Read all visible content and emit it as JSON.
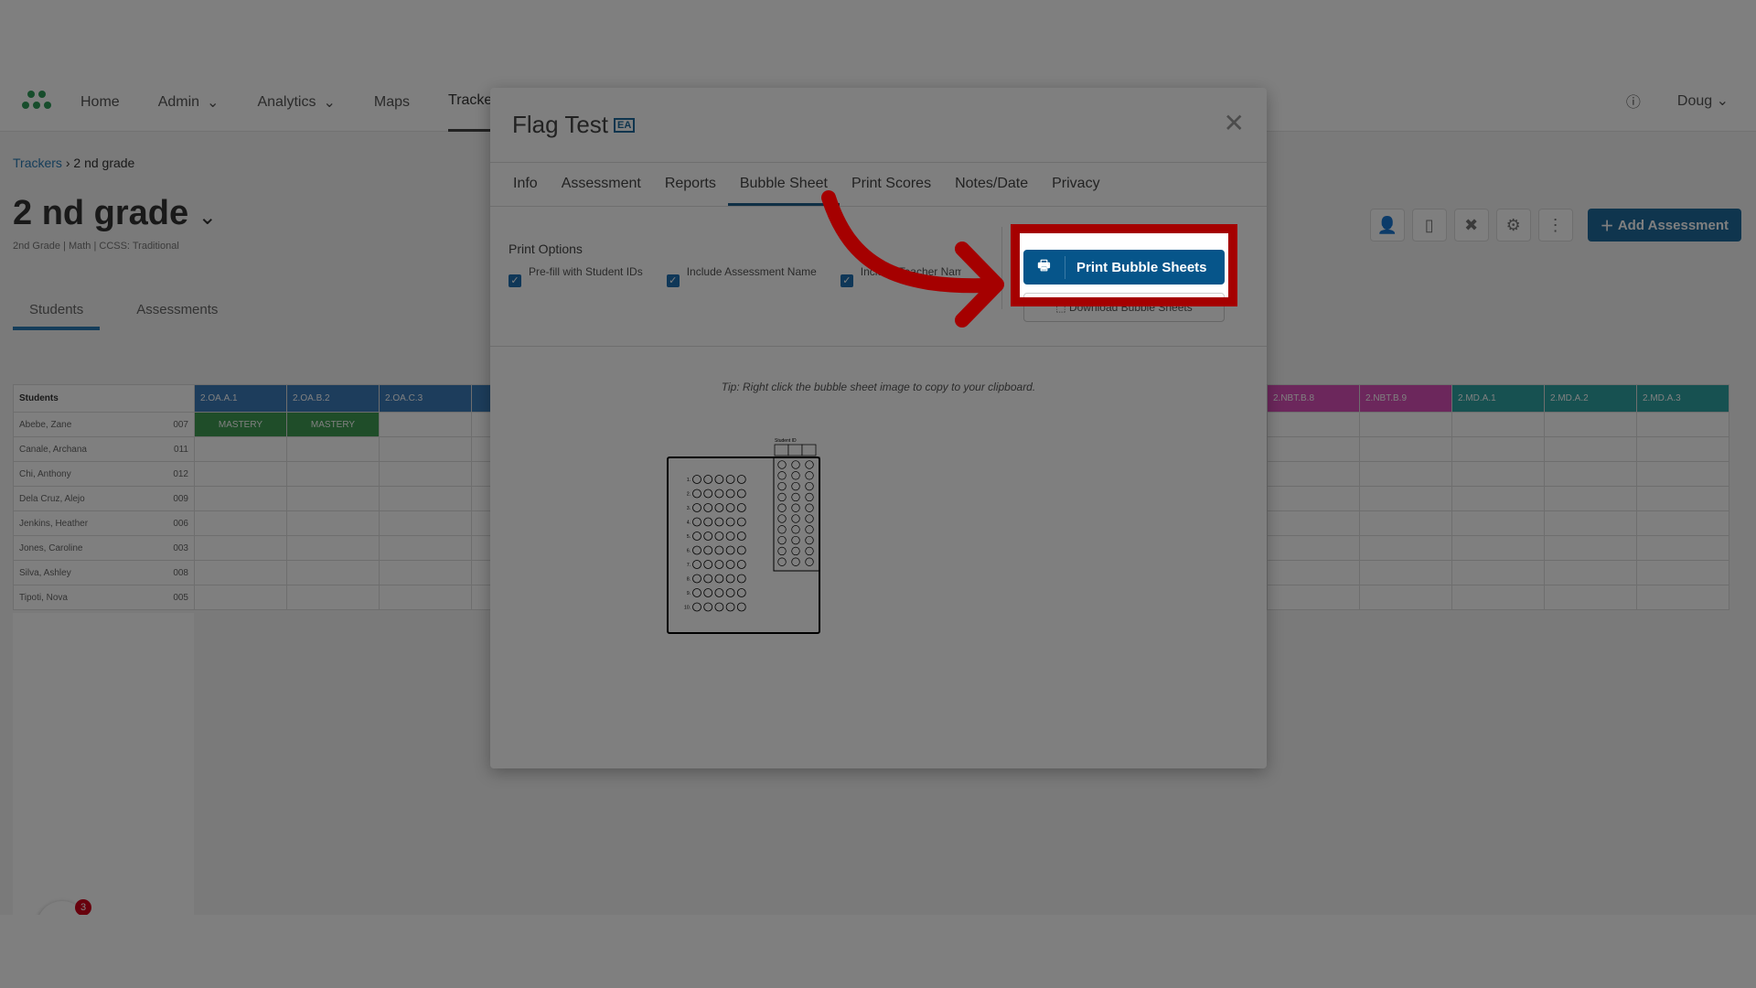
{
  "nav": {
    "items": [
      "Home",
      "Admin",
      "Analytics",
      "Maps",
      "Trackers"
    ],
    "user": "Doug"
  },
  "breadcrumb": {
    "root": "Trackers",
    "current": "2 nd grade"
  },
  "page": {
    "title": "2 nd grade",
    "subtitle": "2nd Grade  |  Math  |  CCSS: Traditional",
    "tabs": [
      "Students",
      "Assessments"
    ],
    "add_button": "Add Assessment"
  },
  "grid": {
    "students_header": "Students",
    "columns": [
      "2.OA.A.1",
      "2.OA.B.2",
      "2.OA.C.3"
    ],
    "right_columns": [
      "2.NBT.B.8",
      "2.NBT.B.9",
      "2.MD.A.1",
      "2.MD.A.2",
      "2.MD.A.3"
    ],
    "rows": [
      {
        "name": "Abebe, Zane",
        "id": "007",
        "cells": [
          "MASTERY",
          "MASTERY",
          ""
        ]
      },
      {
        "name": "Canale, Archana",
        "id": "011"
      },
      {
        "name": "Chi, Anthony",
        "id": "012"
      },
      {
        "name": "Dela Cruz, Alejo",
        "id": "009"
      },
      {
        "name": "Jenkins, Heather",
        "id": "006"
      },
      {
        "name": "Jones, Caroline",
        "id": "003"
      },
      {
        "name": "Silva, Ashley",
        "id": "008"
      },
      {
        "name": "Tipoti, Nova",
        "id": "005"
      }
    ]
  },
  "help_badge": "3",
  "modal": {
    "title": "Flag Test",
    "badge": "EA",
    "tabs": [
      "Info",
      "Assessment",
      "Reports",
      "Bubble Sheet",
      "Print Scores",
      "Notes/Date",
      "Privacy"
    ],
    "active_tab": "Bubble Sheet",
    "print_options_label": "Print Options",
    "options": [
      "Pre-fill with Student IDs",
      "Include Assessment Name",
      "Include Teacher Name"
    ],
    "print_button": "Print Bubble Sheets",
    "download_button": "Download Bubble Sheets",
    "tip": "Tip: Right click the bubble sheet image to copy to your clipboard.",
    "sheet": {
      "student_id_label": "Student ID",
      "questions": 10,
      "choices": [
        "A",
        "B",
        "C",
        "D",
        "E"
      ]
    }
  },
  "colors": {
    "highlight": "#a50000",
    "primary": "#06558a",
    "mastery": "#3f9a52"
  }
}
